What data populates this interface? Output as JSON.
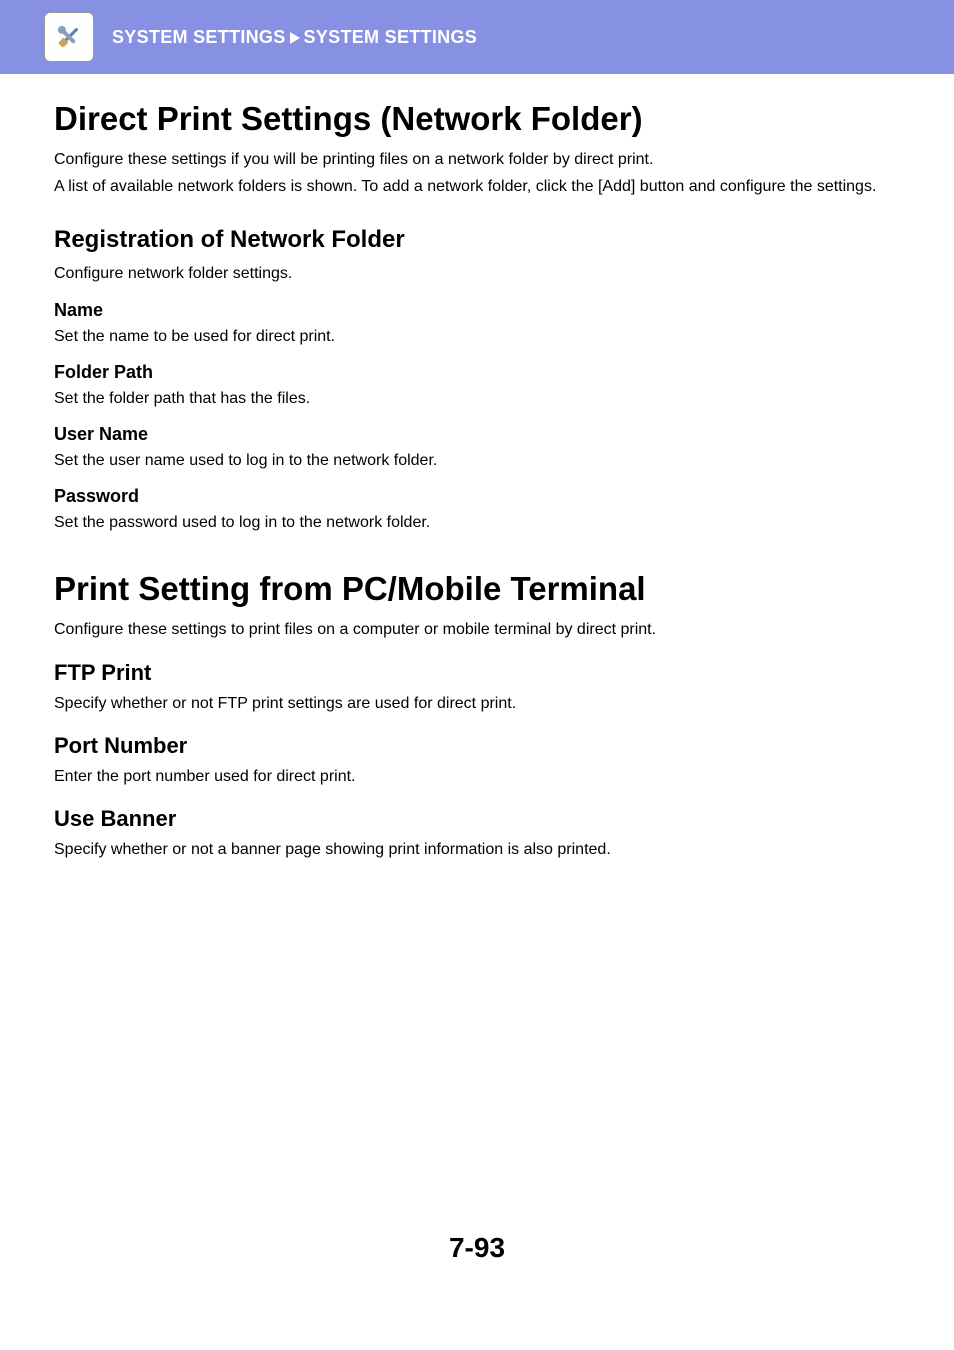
{
  "header": {
    "breadcrumb_left": "SYSTEM SETTINGS",
    "breadcrumb_right": "SYSTEM SETTINGS",
    "icon": "tools-icon"
  },
  "section1": {
    "title": "Direct Print Settings (Network Folder)",
    "desc1": "Configure these settings if you will be printing files on a network folder by direct print.",
    "desc2": "A list of available network folders is shown. To add a network folder, click the [Add] button and configure the settings.",
    "sub": {
      "title": "Registration of Network Folder",
      "desc": "Configure network folder settings.",
      "items": [
        {
          "title": "Name",
          "desc": "Set the name to be used for direct print."
        },
        {
          "title": "Folder Path",
          "desc": "Set the folder path that has the files."
        },
        {
          "title": "User Name",
          "desc": "Set the user name used to log in to the network folder."
        },
        {
          "title": "Password",
          "desc": "Set the password used to log in to the network folder."
        }
      ]
    }
  },
  "section2": {
    "title": "Print Setting from PC/Mobile Terminal",
    "desc": "Configure these settings to print files on a computer or mobile terminal by direct print.",
    "items": [
      {
        "title": "FTP Print",
        "desc": "Specify whether or not FTP print settings are used for direct print."
      },
      {
        "title": "Port Number",
        "desc": "Enter the port number used for direct print."
      },
      {
        "title": "Use Banner",
        "desc": "Specify whether or not a banner page showing print information is also printed."
      }
    ]
  },
  "page_number": "7-93"
}
